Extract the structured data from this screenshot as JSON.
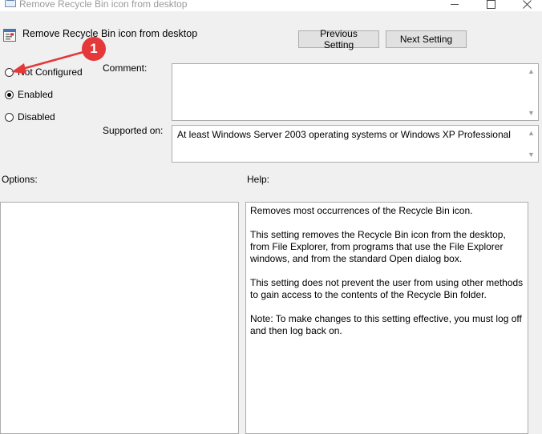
{
  "window": {
    "title": "Remove Recycle Bin icon from desktop",
    "controls": [
      "minimize-icon",
      "maximize-icon",
      "close-icon"
    ]
  },
  "header": {
    "title": "Remove Recycle Bin icon from desktop",
    "icon": "policy-setting-icon",
    "prev_label": "Previous Setting",
    "next_label": "Next Setting"
  },
  "state": {
    "options": [
      {
        "label": "Not Configured",
        "checked": false
      },
      {
        "label": "Enabled",
        "checked": true
      },
      {
        "label": "Disabled",
        "checked": false
      }
    ]
  },
  "comment": {
    "label": "Comment:",
    "value": ""
  },
  "supported": {
    "label": "Supported on:",
    "value": "At least Windows Server 2003 operating systems or Windows XP Professional"
  },
  "options_panel": {
    "label": "Options:"
  },
  "help": {
    "label": "Help:",
    "paragraphs": [
      "Removes most occurrences of the Recycle Bin icon.",
      "This setting removes the Recycle Bin icon from the desktop, from File Explorer, from programs that use the File Explorer windows, and from the standard Open dialog box.",
      "This setting does not prevent the user from using other methods to gain access to the contents of the Recycle Bin folder.",
      "Note: To make changes to this setting effective, you must log off and then log back on."
    ]
  },
  "annotation": {
    "badge": "1",
    "color": "#e5383b"
  },
  "colors": {
    "background": "#f0f0f0",
    "button_face": "#e1e1e1",
    "border": "#adadad"
  }
}
